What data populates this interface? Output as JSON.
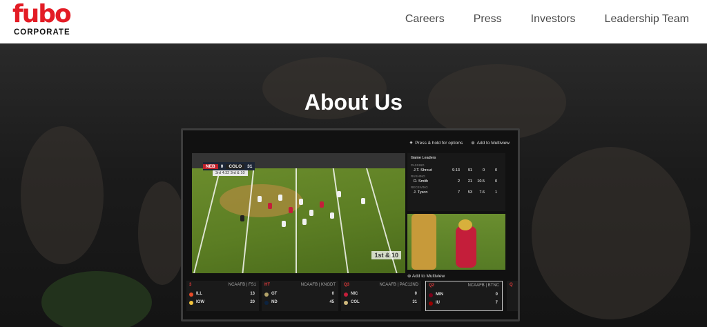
{
  "header": {
    "logo_word": "fubo",
    "logo_sub": "CORPORATE",
    "nav": [
      "Careers",
      "Press",
      "Investors",
      "Leadership Team"
    ]
  },
  "hero": {
    "title": "About Us"
  },
  "tv": {
    "top_options": "Press & hold for options",
    "top_multiview": "Add to Multiview",
    "scorebug": {
      "home": "NEB",
      "home_score": "0",
      "away": "COLO",
      "away_score": "31",
      "meta": "3rd 4:32  3rd & 10"
    },
    "down_marker": "1st & 10",
    "leaders": {
      "title": "Game Leaders",
      "rows": [
        {
          "category": "PASSING",
          "name": "J.T. Shrout",
          "stats": [
            "9-13",
            "91",
            "0",
            "0"
          ]
        },
        {
          "category": "RUSHING",
          "name": "D. Smith",
          "stats": [
            "2",
            "21",
            "10.5",
            "0"
          ]
        },
        {
          "category": "RECEIVING",
          "name": "J. Tyson",
          "stats": [
            "7",
            "53",
            "7.6",
            "1"
          ]
        }
      ]
    },
    "add_multiview": "Add to Multiview",
    "scores": [
      {
        "period": "3",
        "network": "NCAAFB | FS1",
        "teams": [
          {
            "name": "ILL",
            "score": "13",
            "color": "#e84a27"
          },
          {
            "name": "IOW",
            "score": "20",
            "color": "#f2c33d"
          }
        ]
      },
      {
        "period": "HT",
        "network": "NCAAFB | KNGDT",
        "teams": [
          {
            "name": "GT",
            "score": "0",
            "color": "#b3a369"
          },
          {
            "name": "ND",
            "score": "45",
            "color": "#0c2340"
          }
        ]
      },
      {
        "period": "Q3",
        "network": "NCAAFB | PAC12ND",
        "teams": [
          {
            "name": "NIC",
            "score": "0",
            "color": "#c41e3a"
          },
          {
            "name": "COL",
            "score": "31",
            "color": "#cfb87c"
          }
        ]
      },
      {
        "period": "Q2",
        "network": "NCAAFB | BTNC",
        "teams": [
          {
            "name": "MIN",
            "score": "0",
            "color": "#7a0019"
          },
          {
            "name": "IU",
            "score": "7",
            "color": "#990000"
          }
        ]
      },
      {
        "period": "Q",
        "network": "",
        "teams": []
      }
    ]
  }
}
